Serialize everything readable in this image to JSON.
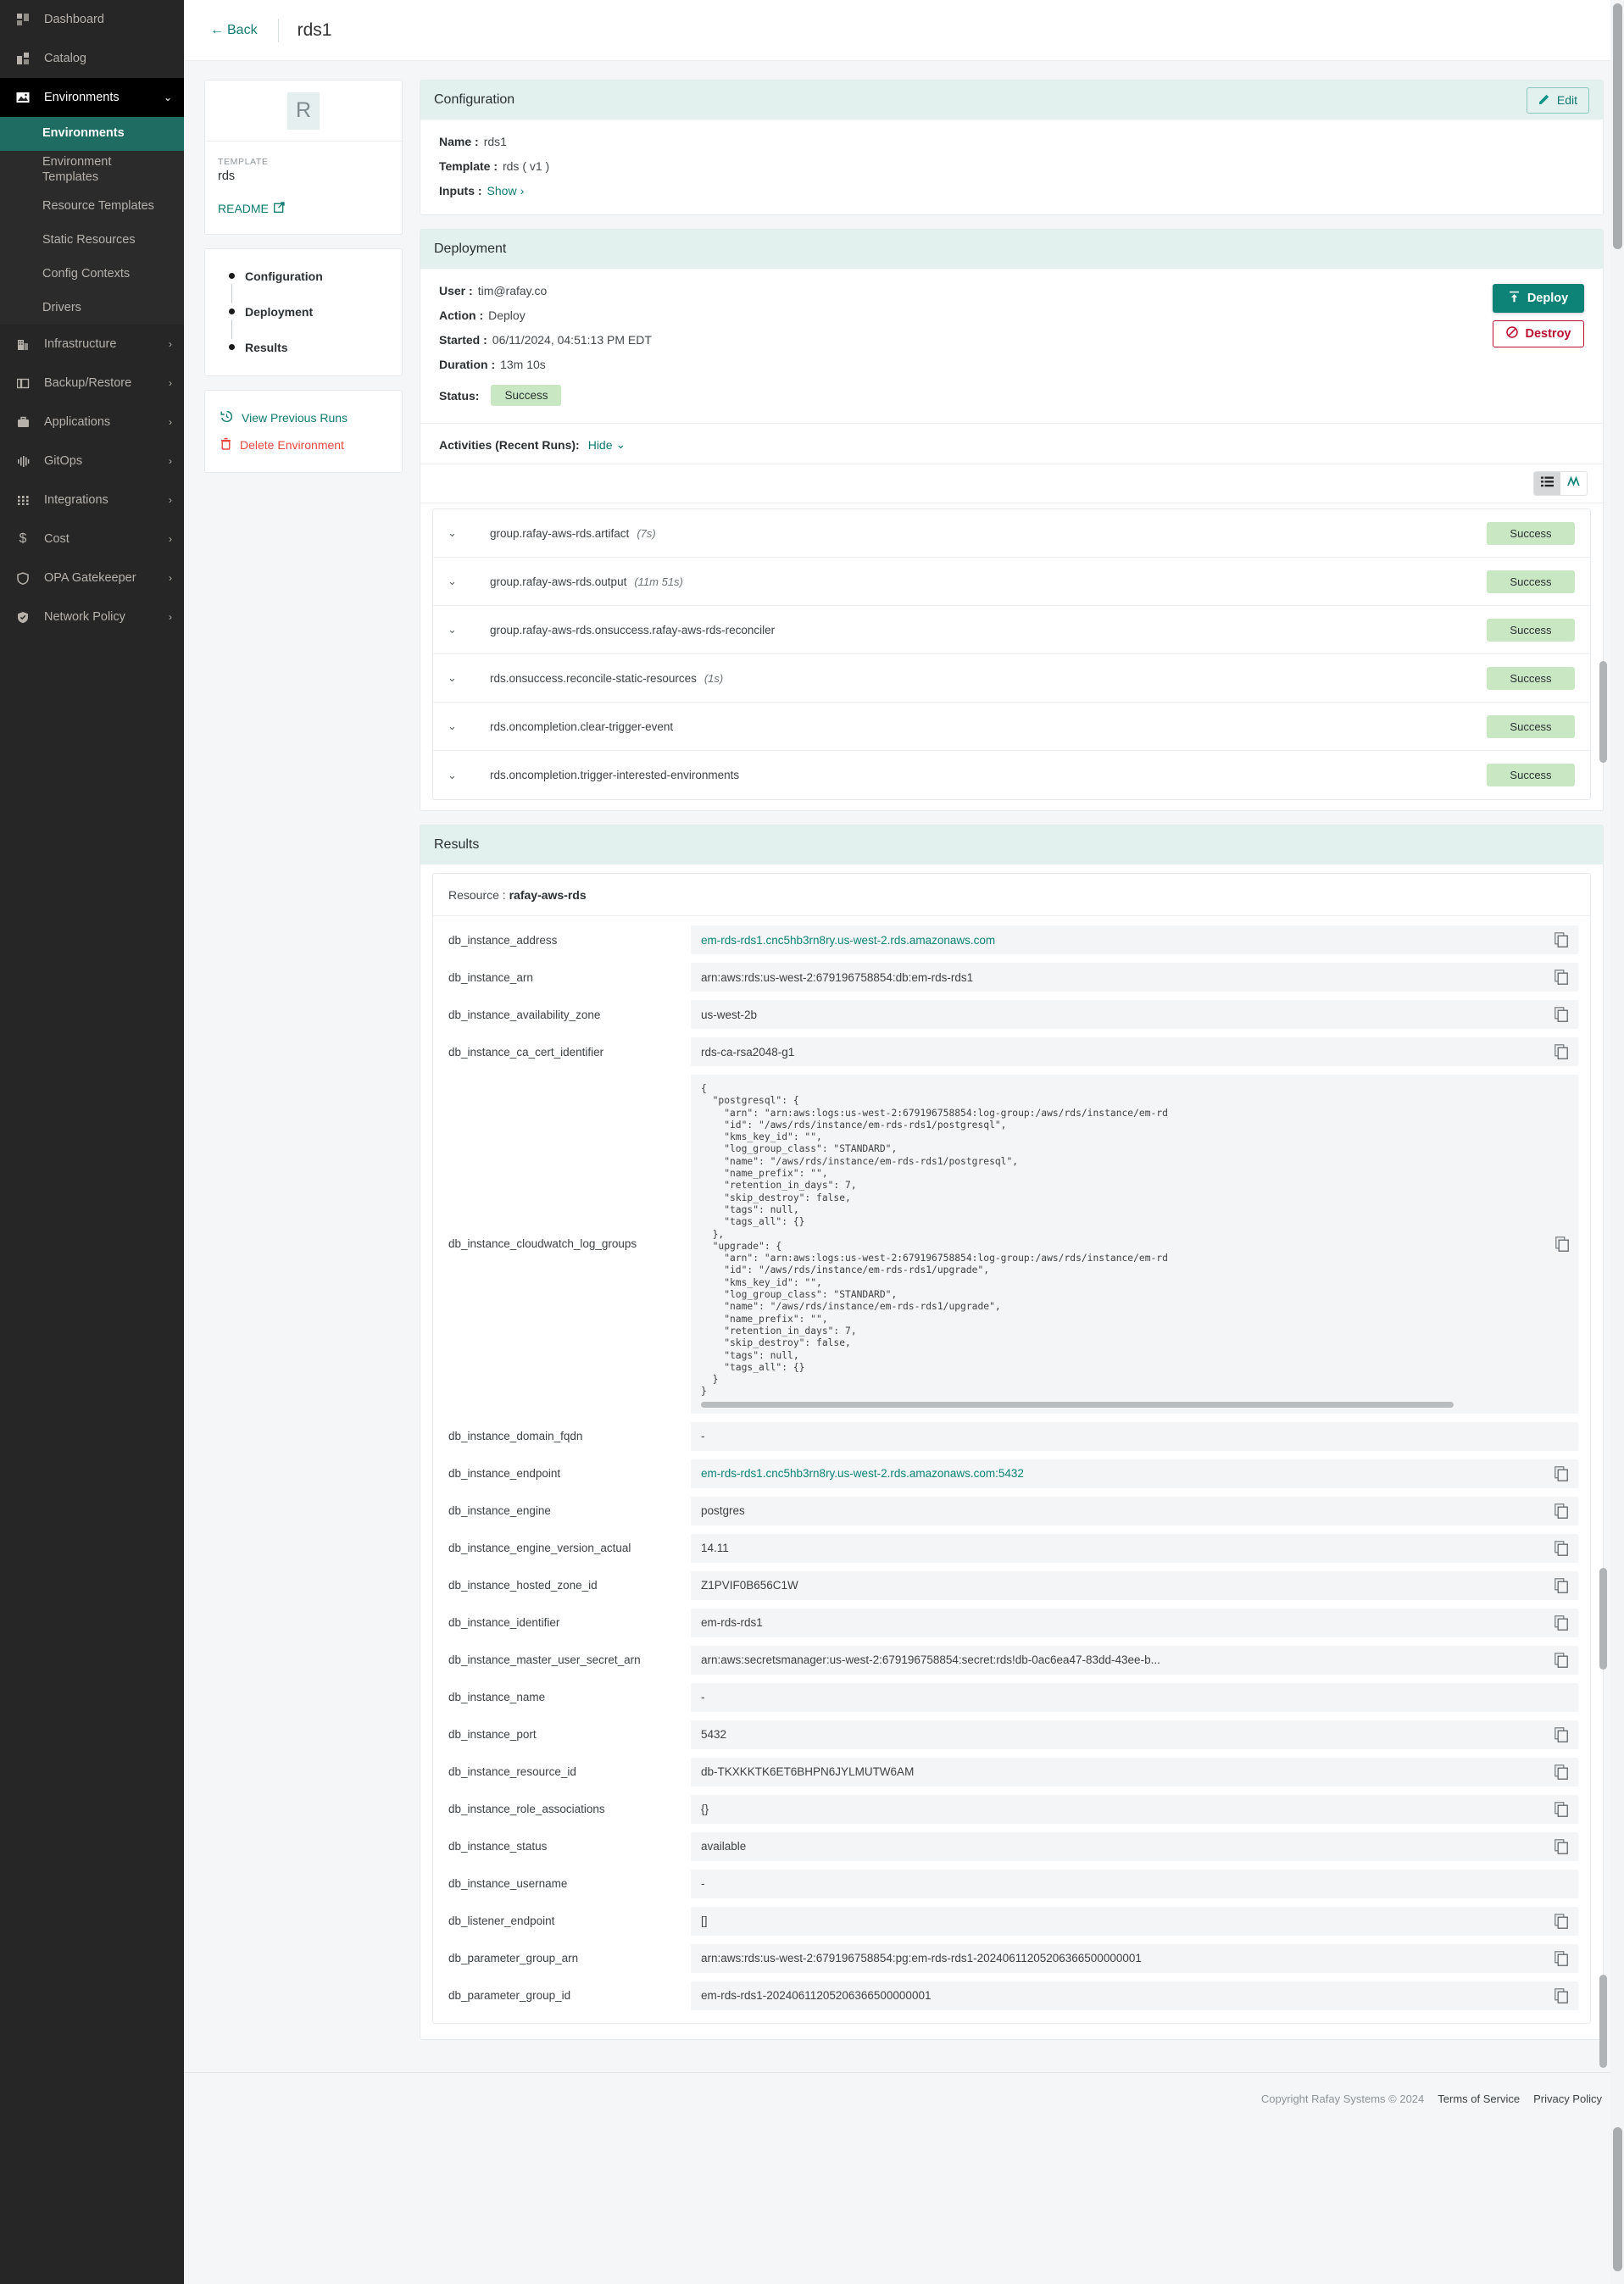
{
  "sidebar": {
    "items": [
      {
        "label": "Dashboard",
        "icon": "dashboard-icon",
        "type": "top"
      },
      {
        "label": "Catalog",
        "icon": "catalog-icon",
        "type": "top"
      },
      {
        "label": "Environments",
        "icon": "environments-icon",
        "type": "expanded",
        "chevron": "chevron-down-icon"
      },
      {
        "label": "Environments",
        "type": "sub",
        "active": true
      },
      {
        "label": "Environment Templates",
        "type": "sub"
      },
      {
        "label": "Resource Templates",
        "type": "sub"
      },
      {
        "label": "Static Resources",
        "type": "sub"
      },
      {
        "label": "Config Contexts",
        "type": "sub"
      },
      {
        "label": "Drivers",
        "type": "sub"
      },
      {
        "label": "Infrastructure",
        "icon": "building-icon",
        "type": "top",
        "chevron": "chevron-right-icon"
      },
      {
        "label": "Backup/Restore",
        "icon": "copy-stack-icon",
        "type": "top",
        "chevron": "chevron-right-icon"
      },
      {
        "label": "Applications",
        "icon": "briefcase-icon",
        "type": "top",
        "chevron": "chevron-right-icon"
      },
      {
        "label": "GitOps",
        "icon": "pipeline-icon",
        "type": "top",
        "chevron": "chevron-right-icon"
      },
      {
        "label": "Integrations",
        "icon": "integrations-icon",
        "type": "top",
        "chevron": "chevron-right-icon"
      },
      {
        "label": "Cost",
        "icon": "dollar-icon",
        "type": "top",
        "chevron": "chevron-right-icon"
      },
      {
        "label": "OPA Gatekeeper",
        "icon": "shield-icon",
        "type": "top",
        "chevron": "chevron-right-icon"
      },
      {
        "label": "Network Policy",
        "icon": "shield-check-icon",
        "type": "top",
        "chevron": "chevron-right-icon"
      }
    ]
  },
  "topbar": {
    "back_label": "Back",
    "title": "rds1"
  },
  "template_card": {
    "avatar_letter": "R",
    "caption": "TEMPLATE",
    "name": "rds",
    "readme_label": "README"
  },
  "steps": [
    {
      "label": "Configuration"
    },
    {
      "label": "Deployment"
    },
    {
      "label": "Results"
    }
  ],
  "actions": [
    {
      "label": "View Previous Runs",
      "icon": "history-icon"
    },
    {
      "label": "Delete Environment",
      "icon": "trash-icon"
    }
  ],
  "configuration": {
    "heading": "Configuration",
    "edit_label": "Edit",
    "name_key": "Name :",
    "name_value": "rds1",
    "template_key": "Template :",
    "template_value": "rds ( v1 )",
    "inputs_key": "Inputs :",
    "inputs_link": "Show"
  },
  "deployment": {
    "heading": "Deployment",
    "rows": [
      {
        "key": "User :",
        "value": "tim@rafay.co"
      },
      {
        "key": "Action :",
        "value": "Deploy"
      },
      {
        "key": "Started :",
        "value": "06/11/2024, 04:51:13 PM EDT"
      },
      {
        "key": "Duration :",
        "value": "13m 10s"
      }
    ],
    "status_key": "Status:",
    "status_value": "Success",
    "deploy_label": "Deploy",
    "destroy_label": "Destroy",
    "activities_label": "Activities (Recent Runs):",
    "activities_toggle": "Hide"
  },
  "activities": [
    {
      "name": "group.rafay-aws-rds.artifact",
      "duration": "(7s)",
      "status": "Success"
    },
    {
      "name": "group.rafay-aws-rds.output",
      "duration": "(11m 51s)",
      "status": "Success"
    },
    {
      "name": "group.rafay-aws-rds.onsuccess.rafay-aws-rds-reconciler",
      "duration": "",
      "status": "Success"
    },
    {
      "name": "rds.onsuccess.reconcile-static-resources",
      "duration": "(1s)",
      "status": "Success"
    },
    {
      "name": "rds.oncompletion.clear-trigger-event",
      "duration": "",
      "status": "Success"
    },
    {
      "name": "rds.oncompletion.trigger-interested-environments",
      "duration": "",
      "status": "Success"
    }
  ],
  "results": {
    "heading": "Results",
    "resource_key": "Resource :",
    "resource_value": "rafay-aws-rds",
    "rows": [
      {
        "key": "db_instance_address",
        "value": "em-rds-rds1.cnc5hb3rn8ry.us-west-2.rds.amazonaws.com",
        "link": true,
        "copy": true
      },
      {
        "key": "db_instance_arn",
        "value": "arn:aws:rds:us-west-2:679196758854:db:em-rds-rds1",
        "copy": true
      },
      {
        "key": "db_instance_availability_zone",
        "value": "us-west-2b",
        "copy": true
      },
      {
        "key": "db_instance_ca_cert_identifier",
        "value": "rds-ca-rsa2048-g1",
        "copy": true
      },
      {
        "key": "db_instance_cloudwatch_log_groups",
        "code": true,
        "copy": true,
        "value": "{\n  \"postgresql\": {\n    \"arn\": \"arn:aws:logs:us-west-2:679196758854:log-group:/aws/rds/instance/em-rd\n    \"id\": \"/aws/rds/instance/em-rds-rds1/postgresql\",\n    \"kms_key_id\": \"\",\n    \"log_group_class\": \"STANDARD\",\n    \"name\": \"/aws/rds/instance/em-rds-rds1/postgresql\",\n    \"name_prefix\": \"\",\n    \"retention_in_days\": 7,\n    \"skip_destroy\": false,\n    \"tags\": null,\n    \"tags_all\": {}\n  },\n  \"upgrade\": {\n    \"arn\": \"arn:aws:logs:us-west-2:679196758854:log-group:/aws/rds/instance/em-rd\n    \"id\": \"/aws/rds/instance/em-rds-rds1/upgrade\",\n    \"kms_key_id\": \"\",\n    \"log_group_class\": \"STANDARD\",\n    \"name\": \"/aws/rds/instance/em-rds-rds1/upgrade\",\n    \"name_prefix\": \"\",\n    \"retention_in_days\": 7,\n    \"skip_destroy\": false,\n    \"tags\": null,\n    \"tags_all\": {}\n  }\n}"
      },
      {
        "key": "db_instance_domain_fqdn",
        "value": "-",
        "copy": false
      },
      {
        "key": "db_instance_endpoint",
        "value": "em-rds-rds1.cnc5hb3rn8ry.us-west-2.rds.amazonaws.com:5432",
        "link": true,
        "copy": true
      },
      {
        "key": "db_instance_engine",
        "value": "postgres",
        "copy": true
      },
      {
        "key": "db_instance_engine_version_actual",
        "value": "14.11",
        "copy": true
      },
      {
        "key": "db_instance_hosted_zone_id",
        "value": "Z1PVIF0B656C1W",
        "copy": true
      },
      {
        "key": "db_instance_identifier",
        "value": "em-rds-rds1",
        "copy": true
      },
      {
        "key": "db_instance_master_user_secret_arn",
        "value": "arn:aws:secretsmanager:us-west-2:679196758854:secret:rds!db-0ac6ea47-83dd-43ee-b...",
        "copy": true
      },
      {
        "key": "db_instance_name",
        "value": "-",
        "copy": false
      },
      {
        "key": "db_instance_port",
        "value": "5432",
        "copy": true
      },
      {
        "key": "db_instance_resource_id",
        "value": "db-TKXKKTK6ET6BHPN6JYLMUTW6AM",
        "copy": true
      },
      {
        "key": "db_instance_role_associations",
        "value": "{}",
        "copy": true
      },
      {
        "key": "db_instance_status",
        "value": "available",
        "copy": true
      },
      {
        "key": "db_instance_username",
        "value": "-",
        "copy": false
      },
      {
        "key": "db_listener_endpoint",
        "value": "[]",
        "copy": true
      },
      {
        "key": "db_parameter_group_arn",
        "value": "arn:aws:rds:us-west-2:679196758854:pg:em-rds-rds1-20240611205206366500000001",
        "copy": true
      },
      {
        "key": "db_parameter_group_id",
        "value": "em-rds-rds1-20240611205206366500000001",
        "copy": true
      }
    ]
  },
  "footer": {
    "copyright": "Copyright Rafay Systems © 2024",
    "terms": "Terms of Service",
    "privacy": "Privacy Policy"
  },
  "colors": {
    "accent": "#0d7a6e",
    "deploy": "#0d8377",
    "destroy": "#ba0c2f",
    "success_bg": "#c9e7c3",
    "panel_head": "#e2f0ee",
    "sidebar": "#262626",
    "sidebar_active": "#1f6c62"
  }
}
